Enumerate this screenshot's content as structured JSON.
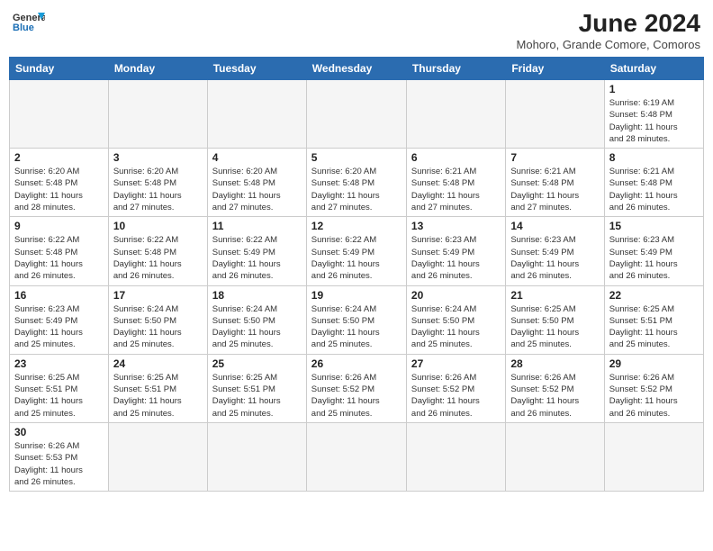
{
  "header": {
    "logo_line1": "General",
    "logo_line2": "Blue",
    "title": "June 2024",
    "subtitle": "Mohoro, Grande Comore, Comoros"
  },
  "weekdays": [
    "Sunday",
    "Monday",
    "Tuesday",
    "Wednesday",
    "Thursday",
    "Friday",
    "Saturday"
  ],
  "days": [
    {
      "num": "",
      "info": ""
    },
    {
      "num": "",
      "info": ""
    },
    {
      "num": "",
      "info": ""
    },
    {
      "num": "",
      "info": ""
    },
    {
      "num": "",
      "info": ""
    },
    {
      "num": "",
      "info": ""
    },
    {
      "num": "1",
      "info": "Sunrise: 6:19 AM\nSunset: 5:48 PM\nDaylight: 11 hours\nand 28 minutes."
    },
    {
      "num": "2",
      "info": "Sunrise: 6:20 AM\nSunset: 5:48 PM\nDaylight: 11 hours\nand 28 minutes."
    },
    {
      "num": "3",
      "info": "Sunrise: 6:20 AM\nSunset: 5:48 PM\nDaylight: 11 hours\nand 27 minutes."
    },
    {
      "num": "4",
      "info": "Sunrise: 6:20 AM\nSunset: 5:48 PM\nDaylight: 11 hours\nand 27 minutes."
    },
    {
      "num": "5",
      "info": "Sunrise: 6:20 AM\nSunset: 5:48 PM\nDaylight: 11 hours\nand 27 minutes."
    },
    {
      "num": "6",
      "info": "Sunrise: 6:21 AM\nSunset: 5:48 PM\nDaylight: 11 hours\nand 27 minutes."
    },
    {
      "num": "7",
      "info": "Sunrise: 6:21 AM\nSunset: 5:48 PM\nDaylight: 11 hours\nand 27 minutes."
    },
    {
      "num": "8",
      "info": "Sunrise: 6:21 AM\nSunset: 5:48 PM\nDaylight: 11 hours\nand 26 minutes."
    },
    {
      "num": "9",
      "info": "Sunrise: 6:22 AM\nSunset: 5:48 PM\nDaylight: 11 hours\nand 26 minutes."
    },
    {
      "num": "10",
      "info": "Sunrise: 6:22 AM\nSunset: 5:48 PM\nDaylight: 11 hours\nand 26 minutes."
    },
    {
      "num": "11",
      "info": "Sunrise: 6:22 AM\nSunset: 5:49 PM\nDaylight: 11 hours\nand 26 minutes."
    },
    {
      "num": "12",
      "info": "Sunrise: 6:22 AM\nSunset: 5:49 PM\nDaylight: 11 hours\nand 26 minutes."
    },
    {
      "num": "13",
      "info": "Sunrise: 6:23 AM\nSunset: 5:49 PM\nDaylight: 11 hours\nand 26 minutes."
    },
    {
      "num": "14",
      "info": "Sunrise: 6:23 AM\nSunset: 5:49 PM\nDaylight: 11 hours\nand 26 minutes."
    },
    {
      "num": "15",
      "info": "Sunrise: 6:23 AM\nSunset: 5:49 PM\nDaylight: 11 hours\nand 26 minutes."
    },
    {
      "num": "16",
      "info": "Sunrise: 6:23 AM\nSunset: 5:49 PM\nDaylight: 11 hours\nand 25 minutes."
    },
    {
      "num": "17",
      "info": "Sunrise: 6:24 AM\nSunset: 5:50 PM\nDaylight: 11 hours\nand 25 minutes."
    },
    {
      "num": "18",
      "info": "Sunrise: 6:24 AM\nSunset: 5:50 PM\nDaylight: 11 hours\nand 25 minutes."
    },
    {
      "num": "19",
      "info": "Sunrise: 6:24 AM\nSunset: 5:50 PM\nDaylight: 11 hours\nand 25 minutes."
    },
    {
      "num": "20",
      "info": "Sunrise: 6:24 AM\nSunset: 5:50 PM\nDaylight: 11 hours\nand 25 minutes."
    },
    {
      "num": "21",
      "info": "Sunrise: 6:25 AM\nSunset: 5:50 PM\nDaylight: 11 hours\nand 25 minutes."
    },
    {
      "num": "22",
      "info": "Sunrise: 6:25 AM\nSunset: 5:51 PM\nDaylight: 11 hours\nand 25 minutes."
    },
    {
      "num": "23",
      "info": "Sunrise: 6:25 AM\nSunset: 5:51 PM\nDaylight: 11 hours\nand 25 minutes."
    },
    {
      "num": "24",
      "info": "Sunrise: 6:25 AM\nSunset: 5:51 PM\nDaylight: 11 hours\nand 25 minutes."
    },
    {
      "num": "25",
      "info": "Sunrise: 6:25 AM\nSunset: 5:51 PM\nDaylight: 11 hours\nand 25 minutes."
    },
    {
      "num": "26",
      "info": "Sunrise: 6:26 AM\nSunset: 5:52 PM\nDaylight: 11 hours\nand 25 minutes."
    },
    {
      "num": "27",
      "info": "Sunrise: 6:26 AM\nSunset: 5:52 PM\nDaylight: 11 hours\nand 26 minutes."
    },
    {
      "num": "28",
      "info": "Sunrise: 6:26 AM\nSunset: 5:52 PM\nDaylight: 11 hours\nand 26 minutes."
    },
    {
      "num": "29",
      "info": "Sunrise: 6:26 AM\nSunset: 5:52 PM\nDaylight: 11 hours\nand 26 minutes."
    },
    {
      "num": "30",
      "info": "Sunrise: 6:26 AM\nSunset: 5:53 PM\nDaylight: 11 hours\nand 26 minutes."
    },
    {
      "num": "",
      "info": ""
    },
    {
      "num": "",
      "info": ""
    },
    {
      "num": "",
      "info": ""
    },
    {
      "num": "",
      "info": ""
    },
    {
      "num": "",
      "info": ""
    },
    {
      "num": "",
      "info": ""
    }
  ]
}
